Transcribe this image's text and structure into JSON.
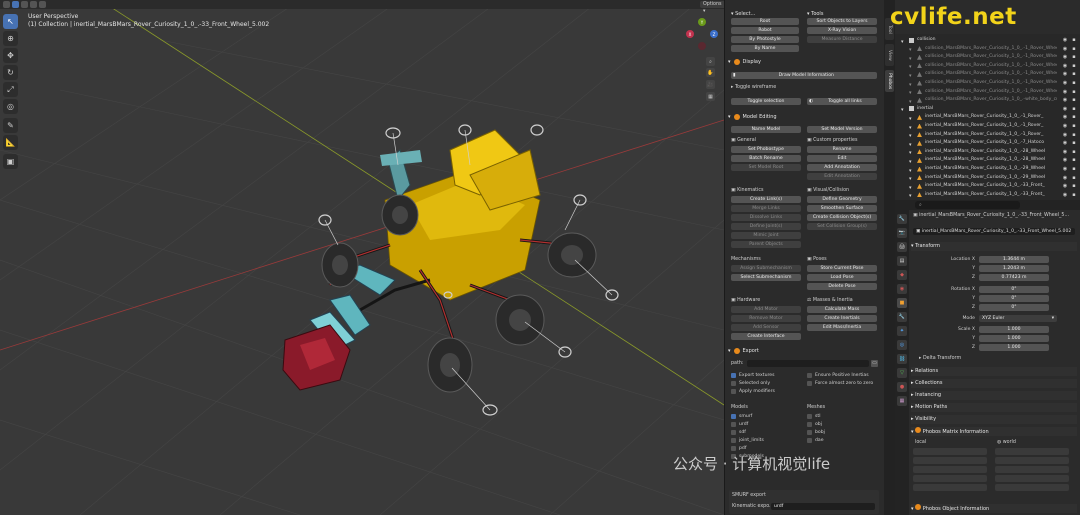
{
  "viewport": {
    "title": "User Perspective",
    "subtitle": "(1) Collection | inertial_MarsBMars_Rover_Curiosity_1_0_.-33_Front_Wheel_5.002",
    "options_label": "Options",
    "tools": [
      "cursor",
      "select",
      "move",
      "rotate",
      "scale",
      "transform",
      "annotate",
      "measure",
      "add-cube"
    ],
    "gizmo": {
      "x": "X",
      "y": "Y",
      "z": "Z"
    }
  },
  "sidepanel": {
    "select": {
      "title": "Select...",
      "buttons": [
        "Root",
        "Robot",
        "By Photostyle",
        "By Name"
      ]
    },
    "tools": {
      "title": "Tools",
      "buttons": [
        "Sort Objects to Layers",
        "X-Ray Vision",
        "Measure Distance"
      ]
    },
    "display": {
      "title": "Display",
      "draw_button": "Draw Model Information",
      "toggle_label": "Toggle wireframe",
      "toggle_selection": "Toggle selection",
      "toggle_all": "Toggle all links"
    },
    "model_editing": {
      "title": "Model Editing",
      "name_model": "Name Model",
      "set_model_version": "Set Model Version",
      "general": "General",
      "general_buttons": [
        "Set Phobostype",
        "Batch Rename",
        "Set Model Root"
      ],
      "custom": "Custom properties",
      "custom_buttons": [
        "Rename",
        "Edit",
        "Add Annotation",
        "Edit Annotation"
      ],
      "kinematics": "Kinematics",
      "kinematics_buttons": [
        "Create Link(s)",
        "Merge Links",
        "Dissolve Links",
        "Define Joint(s)",
        "Mimic Joint",
        "Parent Objects"
      ],
      "visual": "Visual/Collision",
      "visual_buttons": [
        "Define Geometry",
        "Smoothen Surface",
        "Create Collision Object(s)",
        "Set Collision Group(s)"
      ],
      "mechanisms": "Mechanisms",
      "mechanisms_buttons": [
        "Assign Submechanism",
        "Select Submechanism"
      ],
      "poses": "Poses",
      "poses_buttons": [
        "Store Current Pose",
        "Load Pose",
        "Delete Pose"
      ],
      "hardware": "Hardware",
      "hardware_buttons": [
        "Add Motor",
        "Remove Motor",
        "Add Sensor",
        "Create Interface"
      ],
      "masses": "Masses & Inertia",
      "masses_buttons": [
        "Calculate Mass",
        "Create Inertials",
        "Edit Mass/Inertia"
      ]
    },
    "export": {
      "title": "Export",
      "path_label": "path:",
      "options_left": [
        "Export textures",
        "Selected only",
        "Apply modifiers"
      ],
      "options_right": [
        "Ensure Positive Inertias",
        "Force almost zero to zero"
      ],
      "models_title": "Models",
      "models": [
        "smurf",
        "urdf",
        "sdf",
        "joint_limits",
        "pdf",
        "submodels"
      ],
      "meshes_title": "Meshes",
      "meshes": [
        "stl",
        "obj",
        "bobj",
        "dae"
      ],
      "smurf_title": "SMURF export",
      "kinematic_label": "Kinematic expo...",
      "kinematic_value": "urdf"
    }
  },
  "tabs": [
    "Tool",
    "View",
    "Phobos"
  ],
  "outliner": {
    "rows": [
      {
        "name": "collision",
        "level": 0,
        "dim": false
      },
      {
        "name": "collision_MarsBMars_Rover_Curiosity_1_0_.-1_Rover_Wheel_1",
        "level": 1,
        "dim": true
      },
      {
        "name": "collision_MarsBMars_Rover_Curiosity_1_0_.-1_Rover_Wheel_2",
        "level": 1,
        "dim": true
      },
      {
        "name": "collision_MarsBMars_Rover_Curiosity_1_0_.-1_Rover_Wheel_3",
        "level": 1,
        "dim": true
      },
      {
        "name": "collision_MarsBMars_Rover_Curiosity_1_0_.-1_Rover_Wheel_4",
        "level": 1,
        "dim": true
      },
      {
        "name": "collision_MarsBMars_Rover_Curiosity_1_0_.-1_Rover_Wheel_5",
        "level": 1,
        "dim": true
      },
      {
        "name": "collision_MarsBMars_Rover_Curiosity_1_0_.-1_Rover_Wheel_6",
        "level": 1,
        "dim": true
      },
      {
        "name": "collision_MarsBMars_Rover_Curiosity_1_0_.-white_body_cube",
        "level": 1,
        "dim": true
      },
      {
        "name": "inertial",
        "level": 0,
        "dim": false
      },
      {
        "name": "inertial_MarsBMars_Rover_Curiosity_1_0_.-1_Rover_",
        "level": 1,
        "dim": false
      },
      {
        "name": "inertial_MarsBMars_Rover_Curiosity_1_0_.-1_Rover_",
        "level": 1,
        "dim": false
      },
      {
        "name": "inertial_MarsBMars_Rover_Curiosity_1_0_.-1_Rover_",
        "level": 1,
        "dim": false
      },
      {
        "name": "inertial_MarsBMars_Rover_Curiosity_1_0_.-7_Hatoco",
        "level": 1,
        "dim": false
      },
      {
        "name": "inertial_MarsBMars_Rover_Curiosity_1_0_.-28_Wheel",
        "level": 1,
        "dim": false
      },
      {
        "name": "inertial_MarsBMars_Rover_Curiosity_1_0_.-28_Wheel",
        "level": 1,
        "dim": false
      },
      {
        "name": "inertial_MarsBMars_Rover_Curiosity_1_0_.-29_Wheel",
        "level": 1,
        "dim": false
      },
      {
        "name": "inertial_MarsBMars_Rover_Curiosity_1_0_.-29_Wheel",
        "level": 1,
        "dim": false
      },
      {
        "name": "inertial_MarsBMars_Rover_Curiosity_1_0_.-33_Front_",
        "level": 1,
        "dim": false
      },
      {
        "name": "inertial_MarsBMars_Rover_Curiosity_1_0_.-33_Front_",
        "level": 1,
        "dim": false
      }
    ]
  },
  "properties": {
    "header_object": "inertial_MarsBMars_Rover_Curiosity_1_0_.-33_Front_Wheel_5...",
    "object_name": "inertial_MarsBMars_Rover_Curiosity_1_0_.-33_Front_Wheel_5.002",
    "transform_title": "Transform",
    "location": {
      "label_x": "Location X",
      "x": "1.3644 m",
      "y": "1.2043 m",
      "z": "0.77423 m"
    },
    "rotation": {
      "label_x": "Rotation X",
      "x": "0°",
      "y": "0°",
      "z": "0°"
    },
    "mode_label": "Mode",
    "mode_value": "XYZ Euler",
    "scale": {
      "label_x": "Scale X",
      "x": "1.000",
      "y": "1.000",
      "z": "1.000"
    },
    "axis_y": "Y",
    "axis_z": "Z",
    "delta": "Delta Transform",
    "sections": [
      "Relations",
      "Collections",
      "Instancing",
      "Motion Paths",
      "Visibility"
    ],
    "phobos_matrix": "Phobos Matrix Information",
    "local_label": "local",
    "world_label": "world",
    "phobos_object": "Phobos Object Information"
  },
  "watermark": "cvlife.net",
  "watermark2": "公众号 · 计算机视觉life"
}
